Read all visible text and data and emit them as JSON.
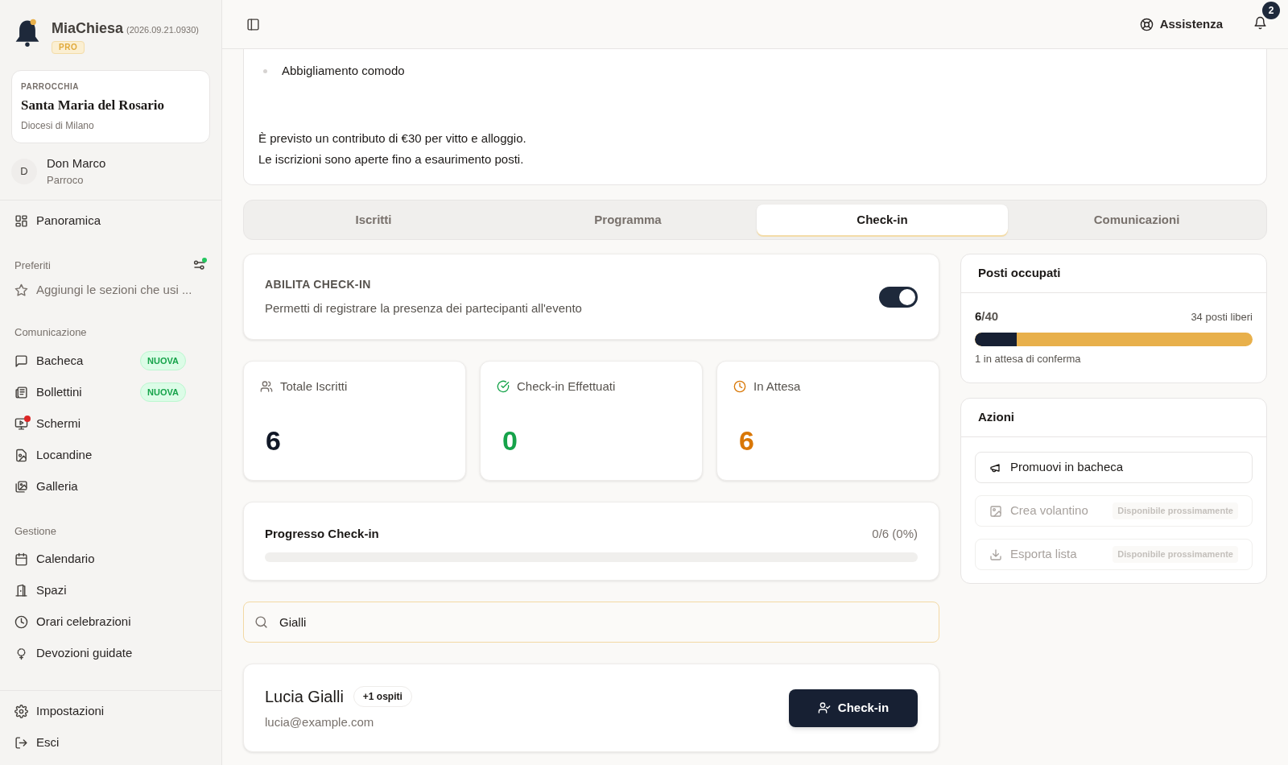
{
  "sidebar": {
    "app": {
      "name": "MiaChiesa",
      "version": "(2026.09.21.0930)",
      "plan": "PRO"
    },
    "parish": {
      "label": "PARROCCHIA",
      "name": "Santa Maria del Rosario",
      "diocese": "Diocesi di Milano"
    },
    "user": {
      "initial": "D",
      "name": "Don Marco",
      "role": "Parroco"
    },
    "top_items": [
      {
        "label": "Panoramica",
        "selected": false
      }
    ],
    "favorites": {
      "title": "Preferiti",
      "placeholder": "Aggiungi le sezioni che usi ..."
    },
    "sections": [
      {
        "title": "Comunicazione",
        "items": [
          {
            "label": "Bacheca",
            "badge": "NUOVA",
            "alert": false,
            "selected": false
          },
          {
            "label": "Bollettini",
            "badge": "NUOVA",
            "alert": false,
            "selected": false
          },
          {
            "label": "Schermi",
            "alert": true,
            "selected": false
          },
          {
            "label": "Locandine",
            "alert": false,
            "selected": false
          },
          {
            "label": "Galleria",
            "alert": false,
            "selected": false
          }
        ]
      },
      {
        "title": "Gestione",
        "items": [
          {
            "label": "Calendario",
            "alert": false,
            "selected": false
          },
          {
            "label": "Spazi",
            "alert": false,
            "selected": false
          },
          {
            "label": "Orari celebrazioni",
            "alert": false,
            "selected": false
          },
          {
            "label": "Devozioni guidate",
            "alert": false,
            "selected": false
          }
        ]
      }
    ],
    "bottom_items": [
      {
        "label": "Impostazioni"
      },
      {
        "label": "Esci"
      }
    ]
  },
  "header": {
    "help": "Assistenza",
    "notifications": "2"
  },
  "description": {
    "bullets": [
      "Abbigliamento comodo"
    ],
    "paragraphs": [
      "È previsto un contributo di €30 per vitto e alloggio.",
      "Le iscrizioni sono aperte fino a esaurimento posti."
    ]
  },
  "tabs": [
    {
      "label": "Iscritti",
      "selected": false
    },
    {
      "label": "Programma",
      "selected": false
    },
    {
      "label": "Check-in",
      "selected": true
    },
    {
      "label": "Comunicazioni",
      "selected": false
    }
  ],
  "checkin_toggle": {
    "title": "ABILITA CHECK-IN",
    "description": "Permetti di registrare la presenza dei partecipanti all'evento",
    "on": true
  },
  "stats": [
    {
      "label": "Totale Iscritti",
      "value": "6",
      "color": "#111827"
    },
    {
      "label": "Check-in Effettuati",
      "value": "0",
      "color": "#16a34a"
    },
    {
      "label": "In Attesa",
      "value": "6",
      "color": "#d97706"
    }
  ],
  "progress": {
    "label": "Progresso Check-in",
    "reading": "0/6 (0%)",
    "level": 0
  },
  "search": {
    "value": "Gialli"
  },
  "attendees": [
    {
      "name": "Lucia Gialli",
      "guests": "+1 ospiti",
      "email": "lucia@example.com",
      "action": "Check-in"
    }
  ],
  "seats": {
    "title": "Posti occupati",
    "taken": "6",
    "total": "/40",
    "free": "34 posti liberi",
    "level": 0.15,
    "pending": "1 in attesa di conferma"
  },
  "actions": {
    "title": "Azioni",
    "items": [
      {
        "label": "Promuovi in bacheca",
        "disabled": false
      },
      {
        "label": "Crea volantino",
        "disabled": true,
        "note": "Disponibile prossimamente"
      },
      {
        "label": "Esporta lista",
        "disabled": true,
        "note": "Disponibile prossimamente"
      }
    ]
  }
}
